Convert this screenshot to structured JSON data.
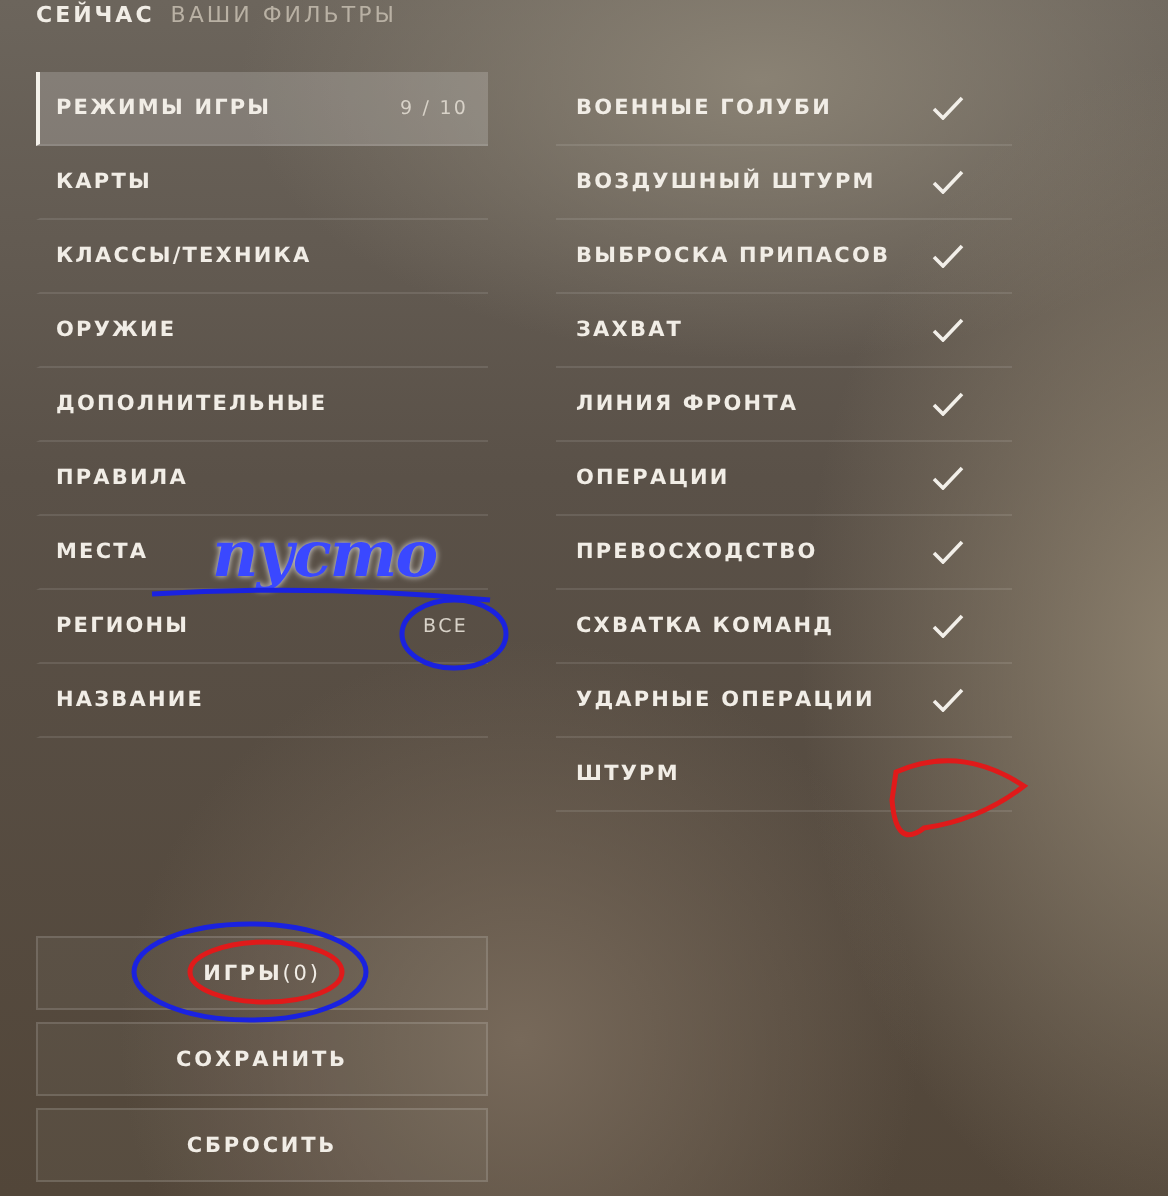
{
  "header": {
    "current": "СЕЙЧАС",
    "section": "ВАШИ ФИЛЬТРЫ"
  },
  "categories": [
    {
      "label": "РЕЖИМЫ ИГРЫ",
      "selected": true,
      "value": "9 / 10"
    },
    {
      "label": "КАРТЫ",
      "selected": false
    },
    {
      "label": "КЛАССЫ/ТЕХНИКА",
      "selected": false
    },
    {
      "label": "ОРУЖИЕ",
      "selected": false
    },
    {
      "label": "ДОПОЛНИТЕЛЬНЫЕ",
      "selected": false
    },
    {
      "label": "ПРАВИЛА",
      "selected": false
    },
    {
      "label": "МЕСТА",
      "selected": false
    },
    {
      "label": "РЕГИОНЫ",
      "selected": false,
      "value": "ВСЕ"
    },
    {
      "label": "НАЗВАНИЕ",
      "selected": false
    }
  ],
  "modes": [
    {
      "label": "ВОЕННЫЕ ГОЛУБИ",
      "checked": true
    },
    {
      "label": "ВОЗДУШНЫЙ ШТУРМ",
      "checked": true
    },
    {
      "label": "ВЫБРОСКА ПРИПАСОВ",
      "checked": true
    },
    {
      "label": "ЗАХВАТ",
      "checked": true
    },
    {
      "label": "ЛИНИЯ ФРОНТА",
      "checked": true
    },
    {
      "label": "ОПЕРАЦИИ",
      "checked": true
    },
    {
      "label": "ПРЕВОСХОДСТВО",
      "checked": true
    },
    {
      "label": "СХВАТКА КОМАНД",
      "checked": true
    },
    {
      "label": "УДАРНЫЕ ОПЕРАЦИИ",
      "checked": true
    },
    {
      "label": "ШТУРМ",
      "checked": false
    }
  ],
  "buttons": [
    {
      "label": "ИГРЫ",
      "count": "(0)"
    },
    {
      "label": "СОХРАНИТЬ"
    },
    {
      "label": "СБРОСИТЬ"
    }
  ],
  "annotation": {
    "note": "пусто"
  }
}
